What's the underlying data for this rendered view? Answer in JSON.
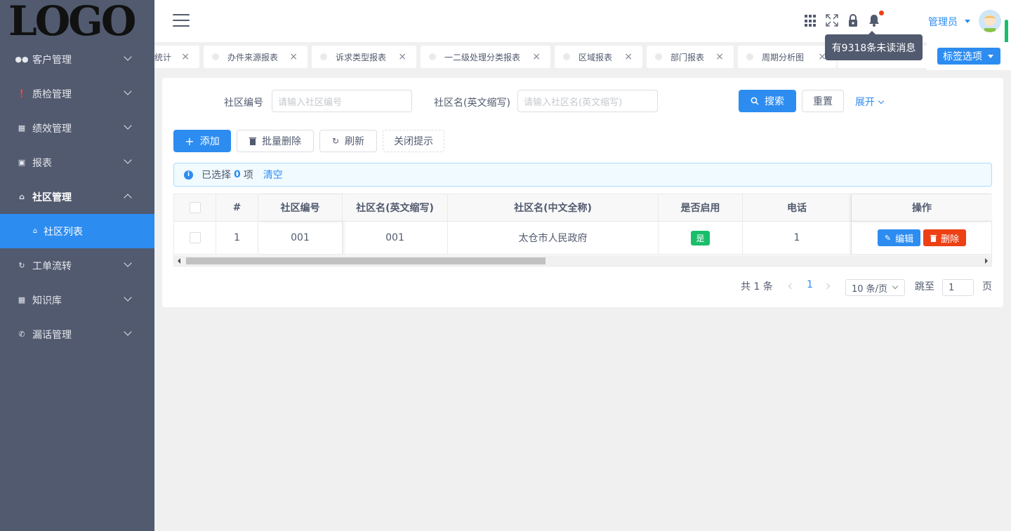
{
  "logo": "LOGO",
  "sidebar": {
    "items": [
      {
        "label": "客户管理",
        "icon": "people-icon"
      },
      {
        "label": "质检管理",
        "icon": "alert-circle-icon"
      },
      {
        "label": "绩效管理",
        "icon": "chart-icon"
      },
      {
        "label": "报表",
        "icon": "briefcase-icon"
      },
      {
        "label": "社区管理",
        "icon": "home-icon"
      },
      {
        "label": "工单流转",
        "icon": "refresh-icon"
      },
      {
        "label": "知识库",
        "icon": "book-icon"
      },
      {
        "label": "漏话管理",
        "icon": "phone-icon"
      }
    ],
    "active_sub": "社区列表"
  },
  "header": {
    "user": "管理员",
    "tooltip": "有9318条未读消息"
  },
  "tabs": [
    {
      "label": "统计"
    },
    {
      "label": "办件来源报表"
    },
    {
      "label": "诉求类型报表"
    },
    {
      "label": "一二级处理分类报表"
    },
    {
      "label": "区域报表"
    },
    {
      "label": "部门报表"
    },
    {
      "label": "周期分析图"
    }
  ],
  "tab_options": "标签选项",
  "search": {
    "code_label": "社区编号",
    "code_placeholder": "请输入社区编号",
    "name_label": "社区名(英文缩写)",
    "name_placeholder": "请输入社区名(英文缩写)",
    "search_btn": "搜索",
    "reset_btn": "重置",
    "expand": "展开"
  },
  "toolbar": {
    "add": "添加",
    "batch_delete": "批量删除",
    "refresh": "刷新",
    "close_tip": "关闭提示"
  },
  "alert": {
    "prefix": "已选择",
    "count": "0",
    "suffix": "项",
    "clear": "清空"
  },
  "table": {
    "columns": [
      "#",
      "社区编号",
      "社区名(英文缩写)",
      "社区名(中文全称)",
      "是否启用",
      "电话",
      "操作"
    ],
    "rows": [
      {
        "index": "1",
        "code": "001",
        "abbr": "001",
        "full_name": "太仓市人民政府",
        "enabled": "是",
        "phone": "1"
      }
    ],
    "edit_btn": "编辑",
    "delete_btn": "删除"
  },
  "pagination": {
    "total": "共 1 条",
    "current": "1",
    "page_size": "10 条/页",
    "jump_label": "跳至",
    "jump_value": "1",
    "page_suffix": "页"
  }
}
